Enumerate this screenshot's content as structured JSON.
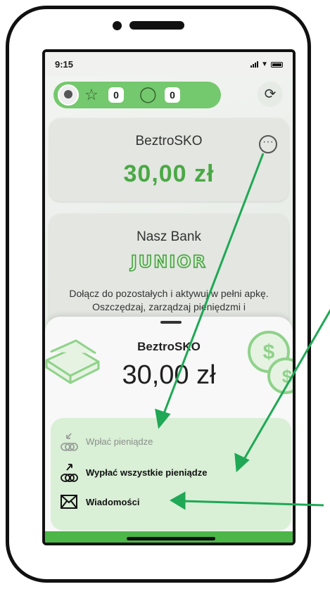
{
  "status_bar": {
    "time": "9:15"
  },
  "header": {
    "stars_count": "0",
    "trophies_count": "0"
  },
  "account_card": {
    "name": "BeztroSKO",
    "balance": "30,00 zł"
  },
  "promo_card": {
    "title": "Nasz Bank",
    "logo_text": "JUNIOR",
    "description": "Dołącz do pozostałych i aktywuj w pełni apkę. Oszczędzaj, zarządzaj pieniędzmi i"
  },
  "sheet": {
    "name": "BeztroSKO",
    "balance": "30,00 zł",
    "actions": [
      {
        "label": "Wpłać pieniądze",
        "icon": "coins-in-icon",
        "enabled": false
      },
      {
        "label": "Wypłać wszystkie pieniądze",
        "icon": "coins-out-icon",
        "enabled": true
      },
      {
        "label": "Wiadomości",
        "icon": "envelope-icon",
        "enabled": true
      }
    ]
  },
  "colors": {
    "accent_green": "#4cb649",
    "balance_green": "#4aa845",
    "action_panel": "#d9efd6",
    "arrow_green": "#1fa855"
  }
}
